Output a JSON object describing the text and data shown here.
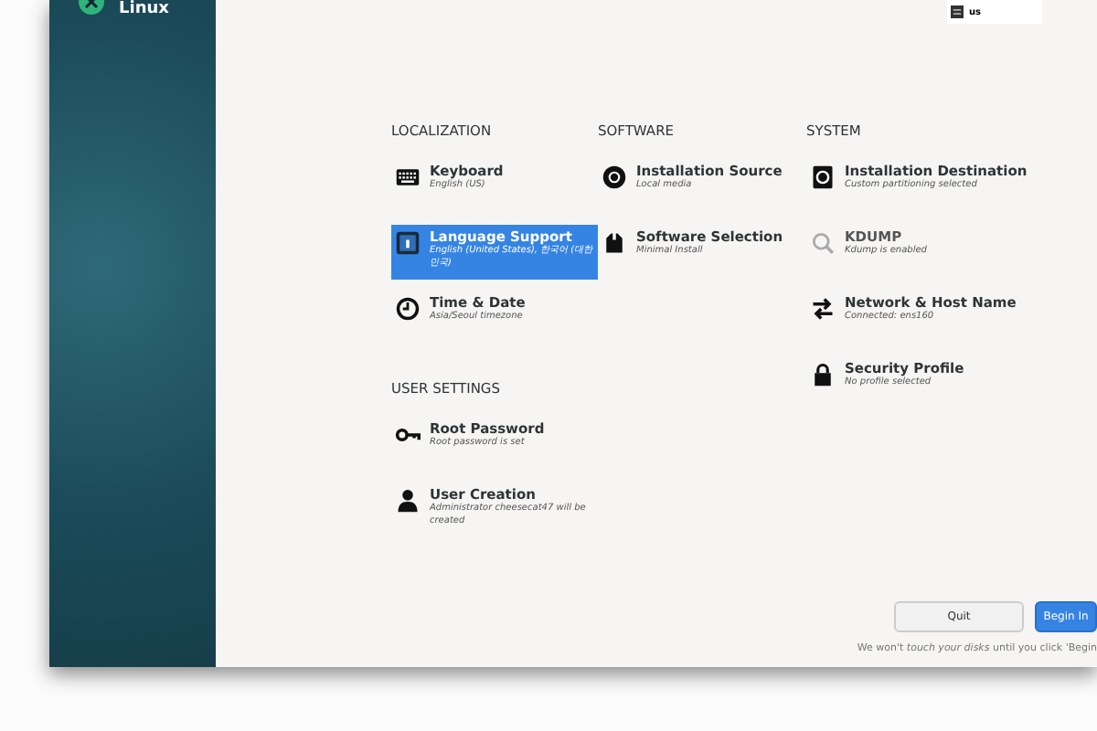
{
  "sidebar": {
    "logo_text": "Linux"
  },
  "keyboard_indicator": {
    "layout": "us"
  },
  "sections": [
    {
      "title": "LOCALIZATION",
      "items": [
        {
          "title": "Keyboard",
          "status": "English (US)",
          "selected": false,
          "disabled": false
        },
        {
          "title": "Language Support",
          "status": "English (United States), 한국어 (대한민국)",
          "selected": true,
          "disabled": false
        },
        {
          "title": "Time & Date",
          "status": "Asia/Seoul timezone",
          "selected": false,
          "disabled": false
        }
      ]
    },
    {
      "title": "SOFTWARE",
      "items": [
        {
          "title": "Installation Source",
          "status": "Local media",
          "selected": false,
          "disabled": false
        },
        {
          "title": "Software Selection",
          "status": "Minimal Install",
          "selected": false,
          "disabled": false
        }
      ]
    },
    {
      "title": "SYSTEM",
      "items": [
        {
          "title": "Installation Destination",
          "status": "Custom partitioning selected",
          "selected": false,
          "disabled": false
        },
        {
          "title": "KDUMP",
          "status": "Kdump is enabled",
          "selected": false,
          "disabled": true
        },
        {
          "title": "Network & Host Name",
          "status": "Connected: ens160",
          "selected": false,
          "disabled": false
        },
        {
          "title": "Security Profile",
          "status": "No profile selected",
          "selected": false,
          "disabled": false
        }
      ]
    },
    {
      "title": "USER SETTINGS",
      "items": [
        {
          "title": "Root Password",
          "status": "Root password is set",
          "selected": false,
          "disabled": false
        },
        {
          "title": "User Creation",
          "status": "Administrator cheesecat47 will be created",
          "selected": false,
          "disabled": false
        }
      ]
    }
  ],
  "buttons": [
    {
      "label": "Quit",
      "kind": "secondary"
    },
    {
      "label": "Begin In",
      "kind": "primary"
    }
  ],
  "footer_note": "We won't *touch your disks* until you click 'Begin"
}
